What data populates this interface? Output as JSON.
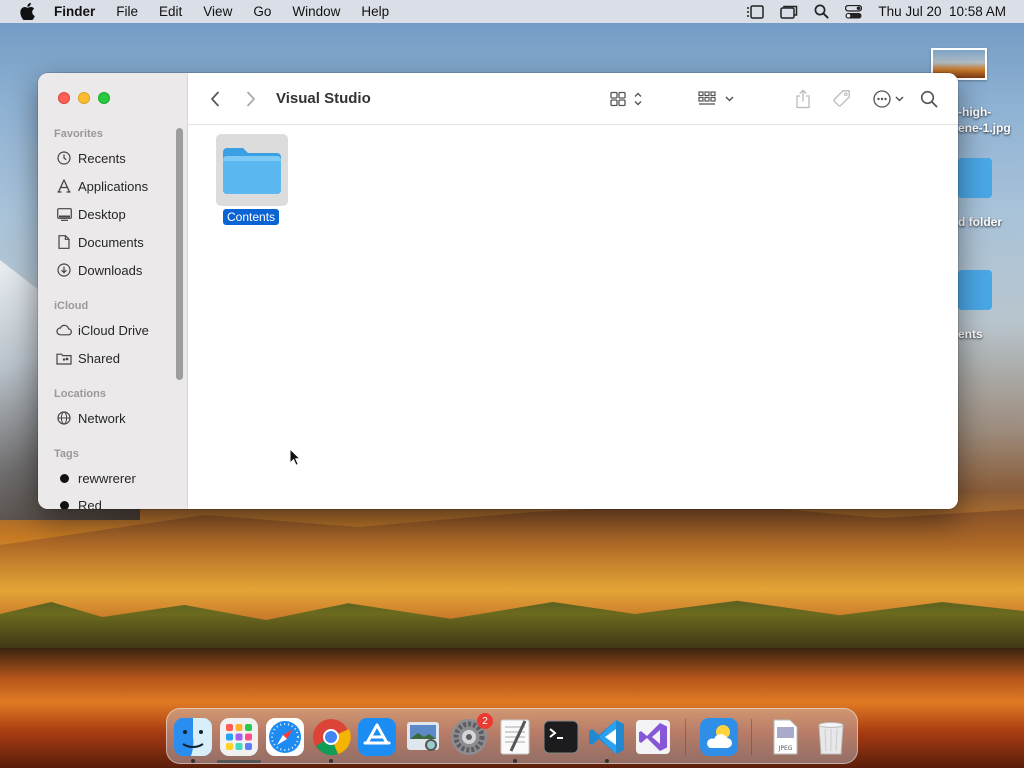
{
  "menubar": {
    "app_name": "Finder",
    "menus": [
      "File",
      "Edit",
      "View",
      "Go",
      "Window",
      "Help"
    ],
    "clock": "Thu Jul 20  10:58 AM"
  },
  "desktop": {
    "items": [
      {
        "label": "-high-\nene-1.jpg",
        "icon": "image-thumbnail-icon"
      },
      {
        "label": "d folder",
        "icon": "folder-icon"
      },
      {
        "label": "ents",
        "icon": "folder-icon"
      }
    ]
  },
  "window": {
    "title": "Visual Studio",
    "sidebar": {
      "sections": [
        {
          "title": "Favorites",
          "items": [
            {
              "label": "Recents",
              "icon": "clock-icon"
            },
            {
              "label": "Applications",
              "icon": "applications-icon"
            },
            {
              "label": "Desktop",
              "icon": "desktop-icon"
            },
            {
              "label": "Documents",
              "icon": "document-icon"
            },
            {
              "label": "Downloads",
              "icon": "download-icon"
            }
          ]
        },
        {
          "title": "iCloud",
          "items": [
            {
              "label": "iCloud Drive",
              "icon": "cloud-icon"
            },
            {
              "label": "Shared",
              "icon": "shared-folder-icon"
            }
          ]
        },
        {
          "title": "Locations",
          "items": [
            {
              "label": "Network",
              "icon": "globe-icon"
            }
          ]
        },
        {
          "title": "Tags",
          "items": [
            {
              "label": "rewwrerer",
              "icon": "tag-dot-black"
            },
            {
              "label": "Red",
              "icon": "tag-dot-black"
            }
          ]
        }
      ]
    },
    "files": [
      {
        "name": "Contents",
        "kind": "folder",
        "selected": true
      }
    ]
  },
  "dock": {
    "apps": [
      "Finder",
      "Launchpad",
      "Safari",
      "Chrome",
      "App Store",
      "Preview",
      "System Settings",
      "TextEdit",
      "Terminal",
      "VS Code",
      "Visual Studio",
      "Weather",
      "JPEG file",
      "Trash"
    ],
    "system_settings_badge": "2"
  },
  "colors": {
    "accent": "#0a64d4",
    "folder": "#4aa7e6",
    "close": "#fe5f57",
    "minimize": "#febc2e",
    "zoom": "#28c840"
  }
}
